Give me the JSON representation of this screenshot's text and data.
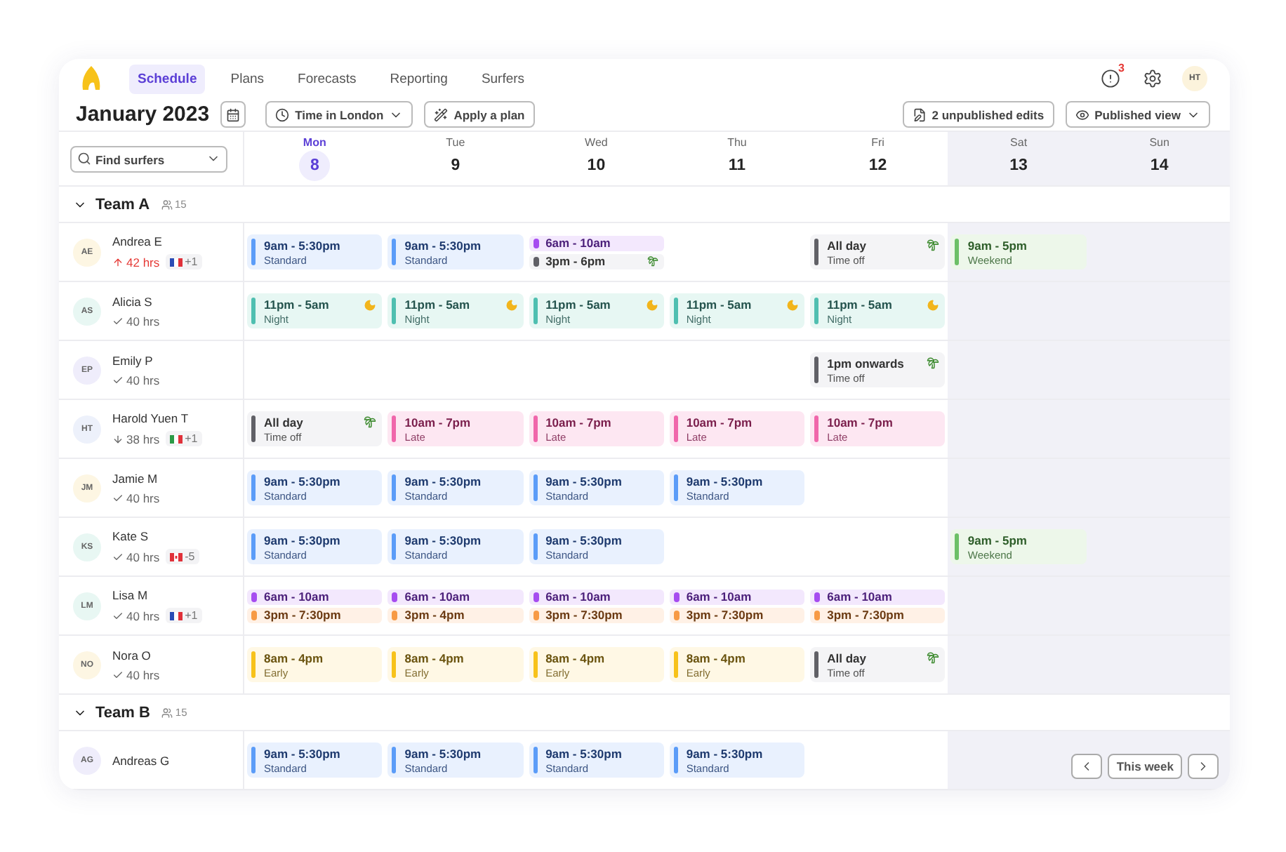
{
  "nav": {
    "tabs": [
      {
        "label": "Schedule",
        "selected": true
      },
      {
        "label": "Plans",
        "selected": false
      },
      {
        "label": "Forecasts",
        "selected": false
      },
      {
        "label": "Reporting",
        "selected": false
      },
      {
        "label": "Surfers",
        "selected": false
      }
    ]
  },
  "notifications": {
    "count": "3"
  },
  "user": {
    "initials": "HT"
  },
  "toolbar": {
    "title": "January 2023",
    "timezone": "Time in London",
    "apply": "Apply a plan",
    "edits": "2 unpublished edits",
    "view": "Published view"
  },
  "search": {
    "placeholder": "Find surfers"
  },
  "days": [
    {
      "day": "Mon",
      "date": "8",
      "selected": true,
      "weekend": false
    },
    {
      "day": "Tue",
      "date": "9",
      "selected": false,
      "weekend": false
    },
    {
      "day": "Wed",
      "date": "10",
      "selected": false,
      "weekend": false
    },
    {
      "day": "Thu",
      "date": "11",
      "selected": false,
      "weekend": false
    },
    {
      "day": "Fri",
      "date": "12",
      "selected": false,
      "weekend": false
    },
    {
      "day": "Sat",
      "date": "13",
      "selected": false,
      "weekend": true
    },
    {
      "day": "Sun",
      "date": "14",
      "selected": false,
      "weekend": true
    }
  ],
  "teams": [
    {
      "name": "Team A",
      "count": "15",
      "expanded": true,
      "surfers": [
        {
          "initials": "AE",
          "name": "Andrea E",
          "color": "#fdf6e3",
          "hours": {
            "kind": "over",
            "text": "42 hrs"
          },
          "flag": {
            "kind": "fr",
            "text": "+1"
          },
          "shifts": {
            "mon": [
              {
                "kind": "standard",
                "time": "9am - 5:30pm",
                "type": "Standard"
              }
            ],
            "tue": [
              {
                "kind": "standard",
                "time": "9am - 5:30pm",
                "type": "Standard"
              }
            ],
            "wed": [
              {
                "kind": "morning",
                "time": "6am - 10am"
              },
              {
                "kind": "timeoff",
                "time": "3pm - 6pm"
              }
            ],
            "fri": [
              {
                "kind": "timeoff",
                "time": "All day",
                "type": "Time off"
              }
            ],
            "sat": [
              {
                "kind": "weekend",
                "time": "9am - 5pm",
                "type": "Weekend"
              }
            ]
          }
        },
        {
          "initials": "AS",
          "name": "Alicia S",
          "color": "#e8f7f3",
          "hours": {
            "kind": "ok",
            "text": "40 hrs"
          },
          "shifts": {
            "mon": [
              {
                "kind": "night",
                "time": "11pm - 5am",
                "type": "Night"
              }
            ],
            "tue": [
              {
                "kind": "night",
                "time": "11pm - 5am",
                "type": "Night"
              }
            ],
            "wed": [
              {
                "kind": "night",
                "time": "11pm - 5am",
                "type": "Night"
              }
            ],
            "thu": [
              {
                "kind": "night",
                "time": "11pm - 5am",
                "type": "Night"
              }
            ],
            "fri": [
              {
                "kind": "night",
                "time": "11pm - 5am",
                "type": "Night"
              }
            ]
          }
        },
        {
          "initials": "EP",
          "name": "Emily P",
          "color": "#efedfb",
          "hours": {
            "kind": "ok",
            "text": "40 hrs"
          },
          "shifts": {
            "fri": [
              {
                "kind": "timeoff",
                "time": "1pm onwards",
                "type": "Time off"
              }
            ]
          }
        },
        {
          "initials": "HT",
          "name": "Harold Yuen T",
          "color": "#edf1fb",
          "hours": {
            "kind": "under",
            "text": "38 hrs"
          },
          "flag": {
            "kind": "it",
            "text": "+1"
          },
          "shifts": {
            "mon": [
              {
                "kind": "timeoff",
                "time": "All day",
                "type": "Time off"
              }
            ],
            "tue": [
              {
                "kind": "late",
                "time": "10am - 7pm",
                "type": "Late"
              }
            ],
            "wed": [
              {
                "kind": "late",
                "time": "10am - 7pm",
                "type": "Late"
              }
            ],
            "thu": [
              {
                "kind": "late",
                "time": "10am - 7pm",
                "type": "Late"
              }
            ],
            "fri": [
              {
                "kind": "late",
                "time": "10am - 7pm",
                "type": "Late"
              }
            ]
          }
        },
        {
          "initials": "JM",
          "name": "Jamie M",
          "color": "#fdf6e3",
          "hours": {
            "kind": "ok",
            "text": "40 hrs"
          },
          "shifts": {
            "mon": [
              {
                "kind": "standard",
                "time": "9am - 5:30pm",
                "type": "Standard"
              }
            ],
            "tue": [
              {
                "kind": "standard",
                "time": "9am - 5:30pm",
                "type": "Standard"
              }
            ],
            "wed": [
              {
                "kind": "standard",
                "time": "9am - 5:30pm",
                "type": "Standard"
              }
            ],
            "thu": [
              {
                "kind": "standard",
                "time": "9am - 5:30pm",
                "type": "Standard"
              }
            ]
          }
        },
        {
          "initials": "KS",
          "name": "Kate S",
          "color": "#e8f7f3",
          "hours": {
            "kind": "ok",
            "text": "40 hrs"
          },
          "flag": {
            "kind": "ca",
            "text": "-5"
          },
          "shifts": {
            "mon": [
              {
                "kind": "standard",
                "time": "9am - 5:30pm",
                "type": "Standard"
              }
            ],
            "tue": [
              {
                "kind": "standard",
                "time": "9am - 5:30pm",
                "type": "Standard"
              }
            ],
            "wed": [
              {
                "kind": "standard",
                "time": "9am - 5:30pm",
                "type": "Standard"
              }
            ],
            "sat": [
              {
                "kind": "weekend",
                "time": "9am - 5pm",
                "type": "Weekend"
              }
            ]
          }
        },
        {
          "initials": "LM",
          "name": "Lisa M",
          "color": "#e8f7f3",
          "hours": {
            "kind": "ok",
            "text": "40 hrs"
          },
          "flag": {
            "kind": "fr",
            "text": "+1"
          },
          "shifts": {
            "mon": [
              {
                "kind": "morning",
                "time": "6am - 10am"
              },
              {
                "kind": "afternoon",
                "time": "3pm - 7:30pm"
              }
            ],
            "tue": [
              {
                "kind": "morning",
                "time": "6am - 10am"
              },
              {
                "kind": "afternoon",
                "time": "3pm - 4pm"
              }
            ],
            "wed": [
              {
                "kind": "morning",
                "time": "6am - 10am"
              },
              {
                "kind": "afternoon",
                "time": "3pm - 7:30pm"
              }
            ],
            "thu": [
              {
                "kind": "morning",
                "time": "6am - 10am"
              },
              {
                "kind": "afternoon",
                "time": "3pm - 7:30pm"
              }
            ],
            "fri": [
              {
                "kind": "morning",
                "time": "6am - 10am"
              },
              {
                "kind": "afternoon",
                "time": "3pm - 7:30pm"
              }
            ]
          }
        },
        {
          "initials": "NO",
          "name": "Nora O",
          "color": "#fdf6e3",
          "hours": {
            "kind": "ok",
            "text": "40 hrs"
          },
          "shifts": {
            "mon": [
              {
                "kind": "early",
                "time": "8am - 4pm",
                "type": "Early"
              }
            ],
            "tue": [
              {
                "kind": "early",
                "time": "8am - 4pm",
                "type": "Early"
              }
            ],
            "wed": [
              {
                "kind": "early",
                "time": "8am - 4pm",
                "type": "Early"
              }
            ],
            "thu": [
              {
                "kind": "early",
                "time": "8am - 4pm",
                "type": "Early"
              }
            ],
            "fri": [
              {
                "kind": "timeoff",
                "time": "All day",
                "type": "Time off"
              }
            ]
          }
        }
      ]
    },
    {
      "name": "Team B",
      "count": "15",
      "expanded": true,
      "surfers": [
        {
          "initials": "AG",
          "name": "Andreas G",
          "color": "#efedfb",
          "shifts": {
            "mon": [
              {
                "kind": "standard",
                "time": "9am - 5:30pm",
                "type": "Standard"
              }
            ],
            "tue": [
              {
                "kind": "standard",
                "time": "9am - 5:30pm",
                "type": "Standard"
              }
            ],
            "wed": [
              {
                "kind": "standard",
                "time": "9am - 5:30pm",
                "type": "Standard"
              }
            ],
            "thu": [
              {
                "kind": "standard",
                "time": "9am - 5:30pm",
                "type": "Standard"
              }
            ]
          }
        }
      ]
    }
  ],
  "week_nav": {
    "label": "This week"
  }
}
